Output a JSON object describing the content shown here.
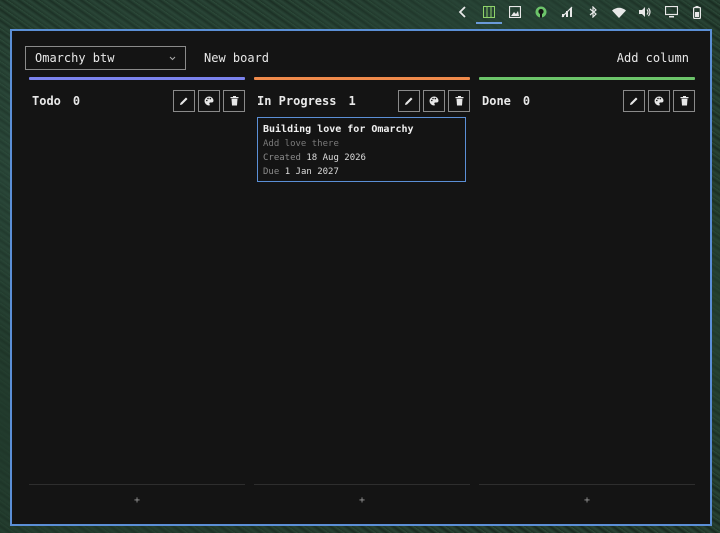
{
  "topbar": {
    "icons": [
      "chevron-left-icon",
      "board-icon",
      "screenshot-icon",
      "github-icon",
      "network-off-icon",
      "bluetooth-icon",
      "wifi-icon",
      "volume-icon",
      "display-icon",
      "battery-icon"
    ]
  },
  "header": {
    "board_name": "Omarchy btw",
    "new_board_label": "New board",
    "add_column_label": "Add column"
  },
  "columns": [
    {
      "title": "Todo",
      "count": "0",
      "color": "#7b83ee",
      "add_label": "+",
      "cards": []
    },
    {
      "title": "In Progress",
      "count": "1",
      "color": "#f08a4b",
      "add_label": "+",
      "cards": [
        {
          "title": "Building love for Omarchy",
          "description": "Add love there",
          "created_label": "Created",
          "created_value": "18 Aug 2026",
          "due_label": "Due",
          "due_value": "1 Jan 2027"
        }
      ]
    },
    {
      "title": "Done",
      "count": "0",
      "color": "#6cc46a",
      "add_label": "+",
      "cards": []
    }
  ],
  "colors": {
    "accent": "#5b8fd6",
    "window_bg": "#141414"
  }
}
